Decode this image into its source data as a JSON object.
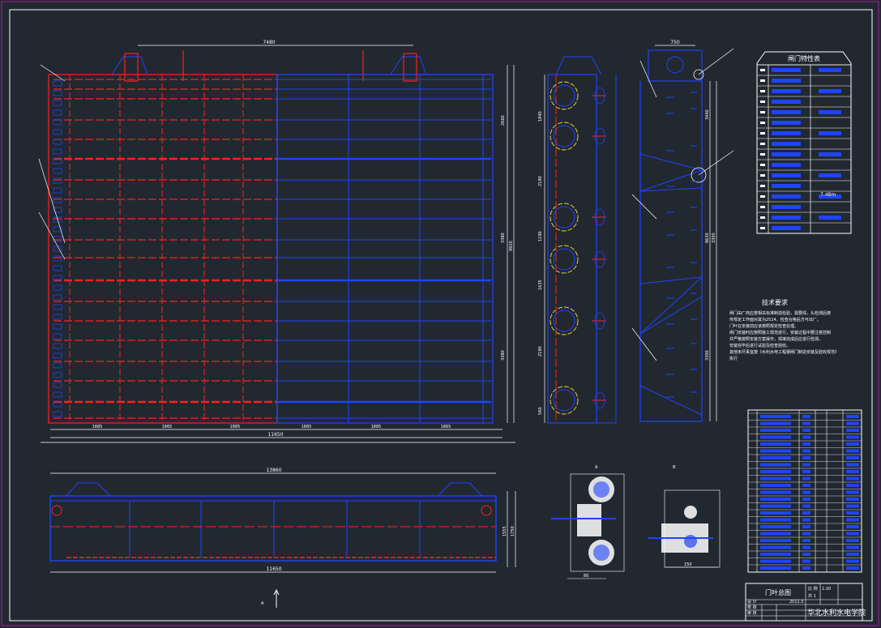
{
  "drawing": {
    "background": "#212830",
    "colors": {
      "frame": "#a21fa0",
      "red": "#ff1f1f",
      "blue": "#1f44ff",
      "white": "#ffffff",
      "magenta": "#ff00ff",
      "yellow": "#e8d42a"
    }
  },
  "elevation": {
    "top_dim": "7480",
    "segment_dims": [
      "1885",
      "1865",
      "1885",
      "1885",
      "1885",
      "1865"
    ],
    "overall_width": "11650",
    "right_dims": [
      "2660",
      "3380",
      "9920",
      "3380"
    ]
  },
  "section_view": {
    "left_dims": [
      "1840",
      "2180",
      "1190",
      "1635",
      "2190",
      "560"
    ]
  },
  "side_view": {
    "top_dim": "750",
    "right_dims": [
      "3440",
      "9630",
      "3300",
      "3300"
    ]
  },
  "characteristics_table": {
    "title": "闸门特性表",
    "highlight_value": "7.48m"
  },
  "technical_requirements": {
    "title": "技术要求",
    "lines": [
      "闸门由厂商应按相关标准制造检验，需要焊，头检测后按",
      "传规定工作面对其为2524，检查合格后方可出厂。",
      "门叶在安装前应该按照规定检查处理。",
      "闸门安装时应按照施工规范进行，安装过程中要注意控制",
      "并严格按照安装方案操作，焊接完成后应进行检测，",
      "安装完毕后进行试验及检查验收。",
      "其他未尽事宜按《水利水电工程钢闸门制造安装及验收规范》",
      "执行"
    ]
  },
  "plan_view": {
    "top_dim": "13860",
    "bottom_dim": "11650",
    "right_dims": [
      "1555",
      "1750"
    ]
  },
  "details": {
    "left_label": "A",
    "right_label": "B",
    "left_dim": "80",
    "right_dim": "150"
  },
  "title_block": {
    "drawing_title": "门叶总图",
    "scale": "1:20",
    "date": "2011.5",
    "school": "华北水利水电学院",
    "scale_label": "比 例",
    "sheet_label": "共 1",
    "row_label_1": "设 计",
    "row_label_2": "校 核",
    "row_label_3": "审 核"
  },
  "north_arrow_label": "A"
}
